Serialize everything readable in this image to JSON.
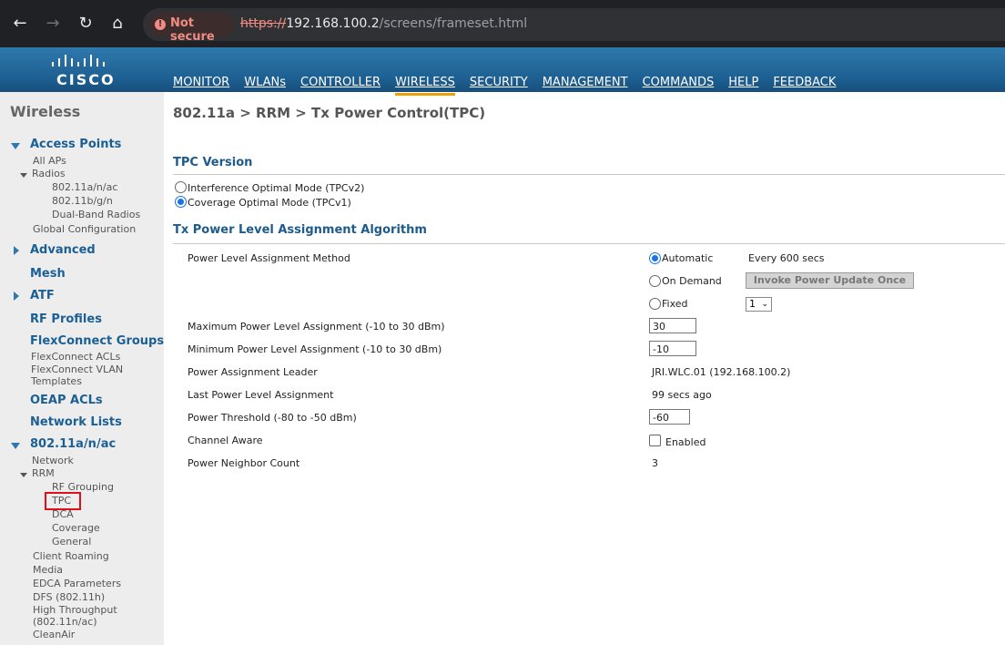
{
  "browser": {
    "security_label": "Not secure",
    "url_scheme": "https://",
    "url_host": "192.168.100.2",
    "url_path": "/screens/frameset.html"
  },
  "header": {
    "logo_text": "CISCO",
    "nav": [
      "MONITOR",
      "WLANs",
      "CONTROLLER",
      "WIRELESS",
      "SECURITY",
      "MANAGEMENT",
      "COMMANDS",
      "HELP",
      "FEEDBACK"
    ],
    "active_nav": "WIRELESS"
  },
  "sidebar": {
    "title": "Wireless",
    "access_points": "Access Points",
    "all_aps": "All APs",
    "radios": "Radios",
    "radio_80211anac": "802.11a/n/ac",
    "radio_80211bgn": "802.11b/g/n",
    "dual_band": "Dual-Band Radios",
    "global_config": "Global Configuration",
    "advanced": "Advanced",
    "mesh": "Mesh",
    "atf": "ATF",
    "rf_profiles": "RF Profiles",
    "flexconnect_groups": "FlexConnect Groups",
    "flexconnect_acls": "FlexConnect ACLs",
    "flexconnect_vlan_1": "FlexConnect VLAN",
    "flexconnect_vlan_2": "Templates",
    "oeap_acls": "OEAP ACLs",
    "network_lists": "Network Lists",
    "band_80211anac": "802.11a/n/ac",
    "network": "Network",
    "rrm": "RRM",
    "rf_grouping": "RF Grouping",
    "tpc": "TPC",
    "dca": "DCA",
    "coverage": "Coverage",
    "general": "General",
    "client_roaming": "Client Roaming",
    "media": "Media",
    "edca": "EDCA Parameters",
    "dfs": "DFS (802.11h)",
    "high_throughput_1": "High Throughput",
    "high_throughput_2": "(802.11n/ac)",
    "cleanair": "CleanAir"
  },
  "main": {
    "breadcrumb": "802.11a > RRM > Tx Power Control(TPC)",
    "tpc_version_heading": "TPC Version",
    "tpc_v2_label": "Interference Optimal Mode (TPCv2)",
    "tpc_v1_label": "Coverage Optimal Mode (TPCv1)",
    "tpc_selected": "TPCv1",
    "algo_heading": "Tx Power Level Assignment Algorithm",
    "method_label": "Power Level Assignment Method",
    "opt_automatic": "Automatic",
    "every_text": "Every 600 secs",
    "opt_on_demand": "On Demand",
    "invoke_button": "Invoke Power Update Once",
    "opt_fixed": "Fixed",
    "fixed_value": "1",
    "method_selected": "Automatic",
    "max_label": "Maximum Power Level Assignment (-10 to 30 dBm)",
    "max_value": "30",
    "min_label": "Minimum Power Level Assignment (-10 to 30 dBm)",
    "min_value": "-10",
    "leader_label": "Power Assignment Leader",
    "leader_value": "JRI.WLC.01 (192.168.100.2)",
    "last_label": "Last Power Level Assignment",
    "last_value": "99 secs ago",
    "threshold_label": "Power Threshold (-80 to -50 dBm)",
    "threshold_value": "-60",
    "channel_aware_label": "Channel Aware",
    "channel_aware_enabled": "Enabled",
    "channel_aware_checked": false,
    "neighbor_label": "Power Neighbor Count",
    "neighbor_value": "3"
  }
}
